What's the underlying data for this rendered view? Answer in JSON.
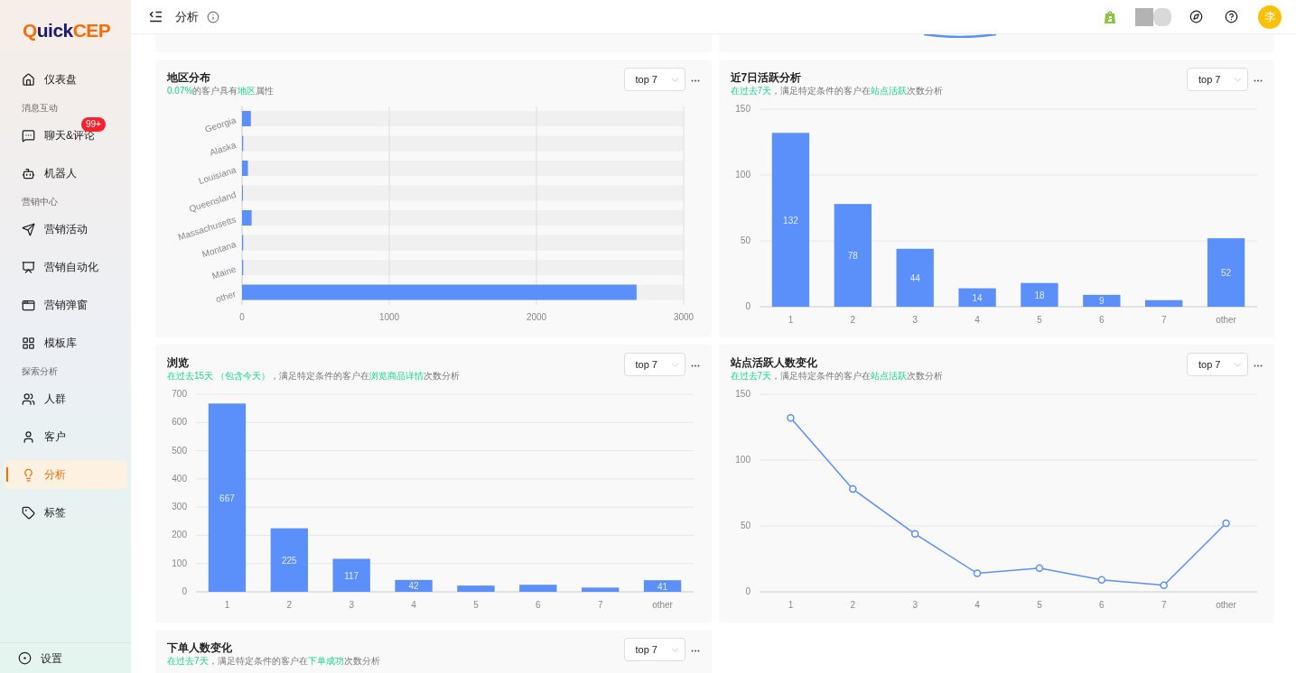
{
  "sidebar": {
    "logo": {
      "lead": "Q",
      "middle": "uick",
      "tail": "CEP"
    },
    "items": [
      {
        "kind": "item",
        "label": "仪表盘",
        "selected": false
      },
      {
        "kind": "section",
        "label": "消息互动"
      },
      {
        "kind": "item",
        "label": "聊天&评论",
        "selected": false,
        "badge": "99+"
      },
      {
        "kind": "item",
        "label": "机器人",
        "selected": false
      },
      {
        "kind": "section",
        "label": "营销中心"
      },
      {
        "kind": "item",
        "label": "营销活动",
        "selected": false
      },
      {
        "kind": "item",
        "label": "营销自动化",
        "selected": false
      },
      {
        "kind": "item",
        "label": "营销弹窗",
        "selected": false
      },
      {
        "kind": "item",
        "label": "模板库",
        "selected": false
      },
      {
        "kind": "section",
        "label": "探索分析"
      },
      {
        "kind": "item",
        "label": "人群",
        "selected": false
      },
      {
        "kind": "item",
        "label": "客户",
        "selected": false
      },
      {
        "kind": "item",
        "label": "分析",
        "selected": true
      },
      {
        "kind": "item",
        "label": "标签",
        "selected": false
      }
    ],
    "footer": {
      "label": "设置"
    }
  },
  "header": {
    "title": "分析",
    "avatar": "李"
  },
  "cards": [
    {
      "title": "地区分布",
      "subtitle": [
        {
          "text": "0.07%",
          "highlight": true
        },
        {
          "text": "的客户具有",
          "highlight": false
        },
        {
          "text": "地区",
          "highlight": true
        },
        {
          "text": "属性",
          "highlight": false
        }
      ],
      "select": "top 7",
      "chart_data": {
        "type": "bar",
        "orientation": "horizontal",
        "categories": [
          "Georgia",
          "Alaska",
          "Louisiana",
          "Queensland",
          "Massachusetts",
          "Montana",
          "Maine",
          "other"
        ],
        "series": [
          {
            "color": "#5b8ff9",
            "values": [
              60,
              8,
              40,
              2,
              65,
              8,
              8,
              2680
            ]
          }
        ],
        "xlim": [
          0,
          3000
        ],
        "xticks": [
          0,
          1000,
          2000,
          3000
        ],
        "grid": true
      }
    },
    {
      "title": "近7日活跃分析",
      "subtitle": [
        {
          "text": "在过去7天",
          "highlight": true
        },
        {
          "text": "，满足特定条件的客户在",
          "highlight": false
        },
        {
          "text": "站点活跃",
          "highlight": true
        },
        {
          "text": "次数分析",
          "highlight": false
        }
      ],
      "select": "top 7",
      "chart_data": {
        "type": "bar",
        "categories": [
          "1",
          "2",
          "3",
          "4",
          "5",
          "6",
          "7",
          "other"
        ],
        "series": [
          {
            "color": "#5b8ff9",
            "values": [
              132,
              78,
              44,
              14,
              18,
              9,
              5,
              52
            ]
          }
        ],
        "ylim": [
          0,
          150
        ],
        "yticks": [
          0,
          50,
          100,
          150
        ],
        "grid": true,
        "value_labels": [
          "132",
          "78",
          "44",
          "14",
          "18",
          "9",
          null,
          "52"
        ]
      }
    },
    {
      "title": "浏览",
      "subtitle": [
        {
          "text": "在过去15天 （包含今天）",
          "highlight": true
        },
        {
          "text": "，满足特定条件的客户在",
          "highlight": false
        },
        {
          "text": "浏览商品详情",
          "highlight": true
        },
        {
          "text": "次数分析",
          "highlight": false
        }
      ],
      "select": "top 7",
      "chart_data": {
        "type": "bar",
        "categories": [
          "1",
          "2",
          "3",
          "4",
          "5",
          "6",
          "7",
          "other"
        ],
        "series": [
          {
            "color": "#5b8ff9",
            "values": [
              667,
              225,
              117,
              42,
              22,
              25,
              15,
              41
            ]
          }
        ],
        "ylim": [
          0,
          700
        ],
        "yticks": [
          0,
          100,
          200,
          300,
          400,
          500,
          600,
          700
        ],
        "grid": true,
        "value_labels": [
          "667",
          "225",
          "117",
          "42",
          null,
          null,
          null,
          "41"
        ]
      }
    },
    {
      "title": "站点活跃人数变化",
      "subtitle": [
        {
          "text": "在过去7天",
          "highlight": true
        },
        {
          "text": "，满足特定条件的客户在",
          "highlight": false
        },
        {
          "text": "站点活跃",
          "highlight": true
        },
        {
          "text": "次数分析",
          "highlight": false
        }
      ],
      "select": "top 7",
      "chart_data": {
        "type": "line",
        "categories": [
          "1",
          "2",
          "3",
          "4",
          "5",
          "6",
          "7",
          "other"
        ],
        "series": [
          {
            "color": "#5b8ff9",
            "values": [
              132,
              78,
              44,
              14,
              18,
              9,
              5,
              52
            ],
            "marker": true
          }
        ],
        "ylim": [
          0,
          150
        ],
        "yticks": [
          0,
          50,
          100,
          150
        ],
        "grid": true
      }
    },
    {
      "title": "下单人数变化",
      "subtitle": [
        {
          "text": "在过去7天",
          "highlight": true
        },
        {
          "text": "，满足特定条件的客户在",
          "highlight": false
        },
        {
          "text": "下单成功",
          "highlight": true
        },
        {
          "text": "次数分析",
          "highlight": false
        }
      ],
      "select": "top 7"
    }
  ]
}
